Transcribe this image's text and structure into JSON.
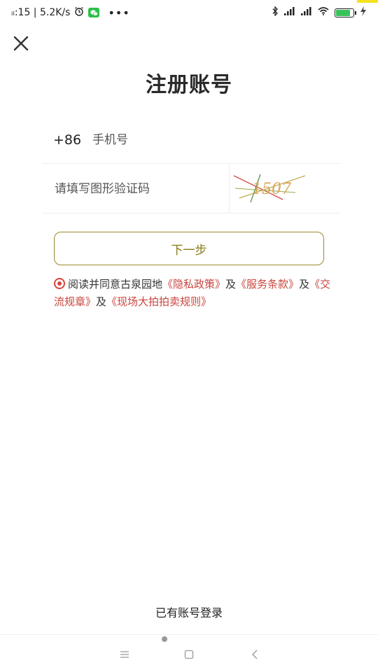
{
  "status_bar": {
    "time_speed": "ᵢₗ:15 | 5.2K/s",
    "battery_level": 0.85,
    "battery_color": "#3ac25a",
    "icons": [
      "alarm-icon",
      "wechat-icon",
      "more-icon",
      "bluetooth-icon",
      "signal-icon",
      "signal-icon",
      "wifi-icon",
      "battery-icon",
      "charging-icon"
    ]
  },
  "header": {
    "title": "注册账号",
    "close_icon": "close-icon"
  },
  "form": {
    "country_code": "+86",
    "phone_placeholder": "手机号",
    "captcha_placeholder": "请填写图形验证码",
    "captcha_text": "1507"
  },
  "actions": {
    "next_label": "下一步",
    "login_label": "已有账号登录"
  },
  "agreement": {
    "prefix": "阅读并同意古泉园地",
    "privacy": "《隐私政策》",
    "and1": "及",
    "service": "《服务条款》",
    "and2": "及",
    "exchange": "《交流规章》",
    "and3": "及",
    "auction": "《现场大拍拍卖规则》"
  },
  "colors": {
    "accent_gold": "#8a7a12",
    "link_red": "#c8453c"
  },
  "nav_bar": {
    "icons": [
      "menu-icon",
      "home-icon",
      "back-icon"
    ]
  }
}
